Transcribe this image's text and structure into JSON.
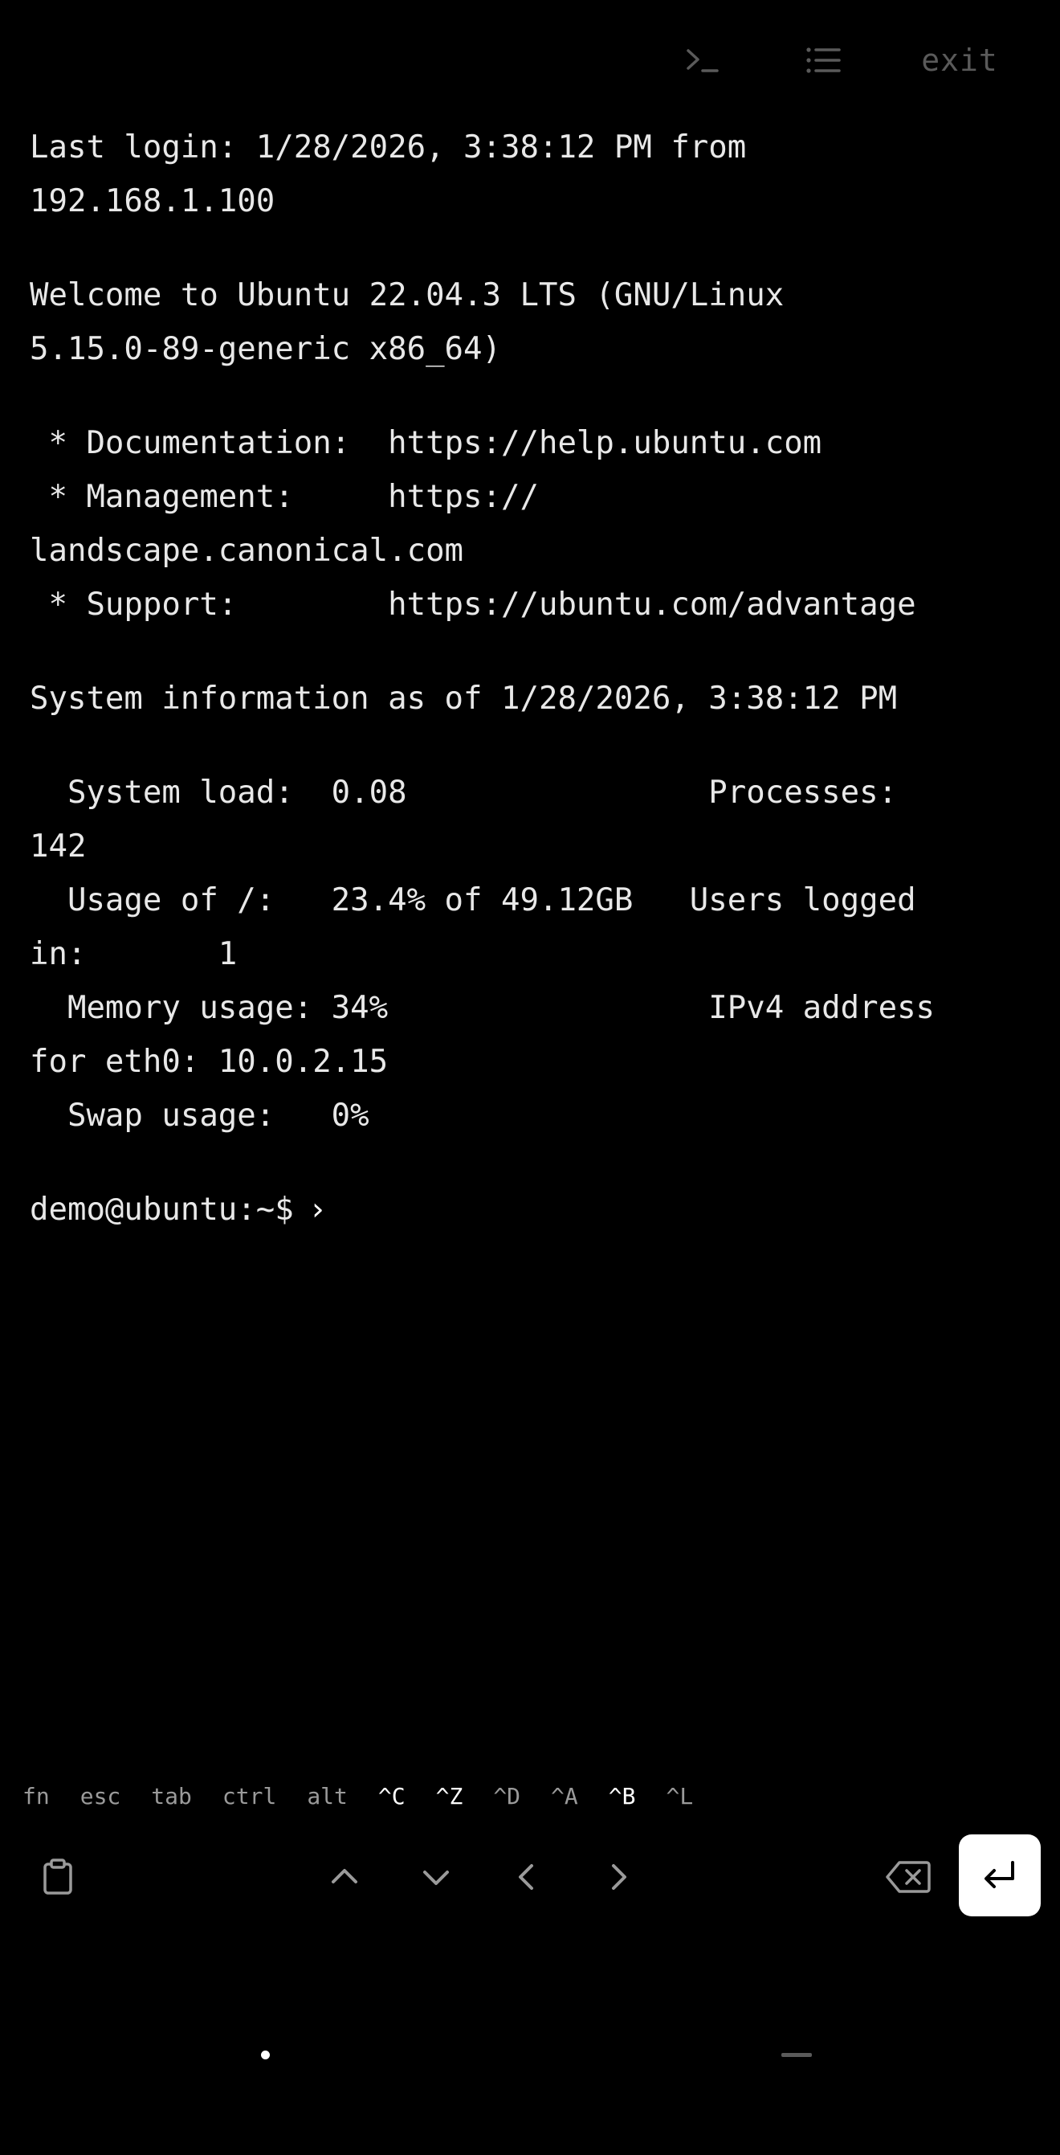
{
  "toolbar": {
    "terminal_icon": "terminal-prompt-icon",
    "list_icon": "list-icon",
    "exit_label": "exit"
  },
  "terminal": {
    "lines": [
      "Last login: 1/28/2026, 3:38:12 PM from",
      "192.168.1.100",
      "",
      "Welcome to Ubuntu 22.04.3 LTS (GNU/Linux",
      "5.15.0-89-generic x86_64)",
      "",
      " * Documentation:  https://help.ubuntu.com",
      " * Management:     https://",
      "landscape.canonical.com",
      " * Support:        https://ubuntu.com/advantage",
      "",
      "System information as of 1/28/2026, 3:38:12 PM",
      "",
      "  System load:  0.08                Processes:",
      "142",
      "  Usage of /:   23.4% of 49.12GB   Users logged",
      "in:       1",
      "  Memory usage: 34%                 IPv4 address",
      "for eth0: 10.0.2.15",
      "  Swap usage:   0%",
      ""
    ],
    "prompt": "demo@ubuntu:~$",
    "cursor": "›"
  },
  "extra_keys": [
    {
      "label": "fn",
      "highlight": false
    },
    {
      "label": "esc",
      "highlight": false
    },
    {
      "label": "tab",
      "highlight": false
    },
    {
      "label": "ctrl",
      "highlight": false
    },
    {
      "label": "alt",
      "highlight": false
    },
    {
      "label": "^C",
      "highlight": true
    },
    {
      "label": "^Z",
      "highlight": true
    },
    {
      "label": "^D",
      "highlight": false
    },
    {
      "label": "^A",
      "highlight": false
    },
    {
      "label": "^B",
      "highlight": true
    },
    {
      "label": "^L",
      "highlight": false
    }
  ],
  "controls": {
    "clipboard_icon": "clipboard-icon",
    "up_icon": "chevron-up-icon",
    "down_icon": "chevron-down-icon",
    "left_icon": "chevron-left-icon",
    "right_icon": "chevron-right-icon",
    "backspace_icon": "backspace-icon",
    "enter_icon": "enter-icon"
  },
  "colors": {
    "background": "#000000",
    "text": "#e8e8e8",
    "muted": "#5a5a5a",
    "key_dim": "#9a9a9a",
    "enter_bg": "#ffffff"
  }
}
